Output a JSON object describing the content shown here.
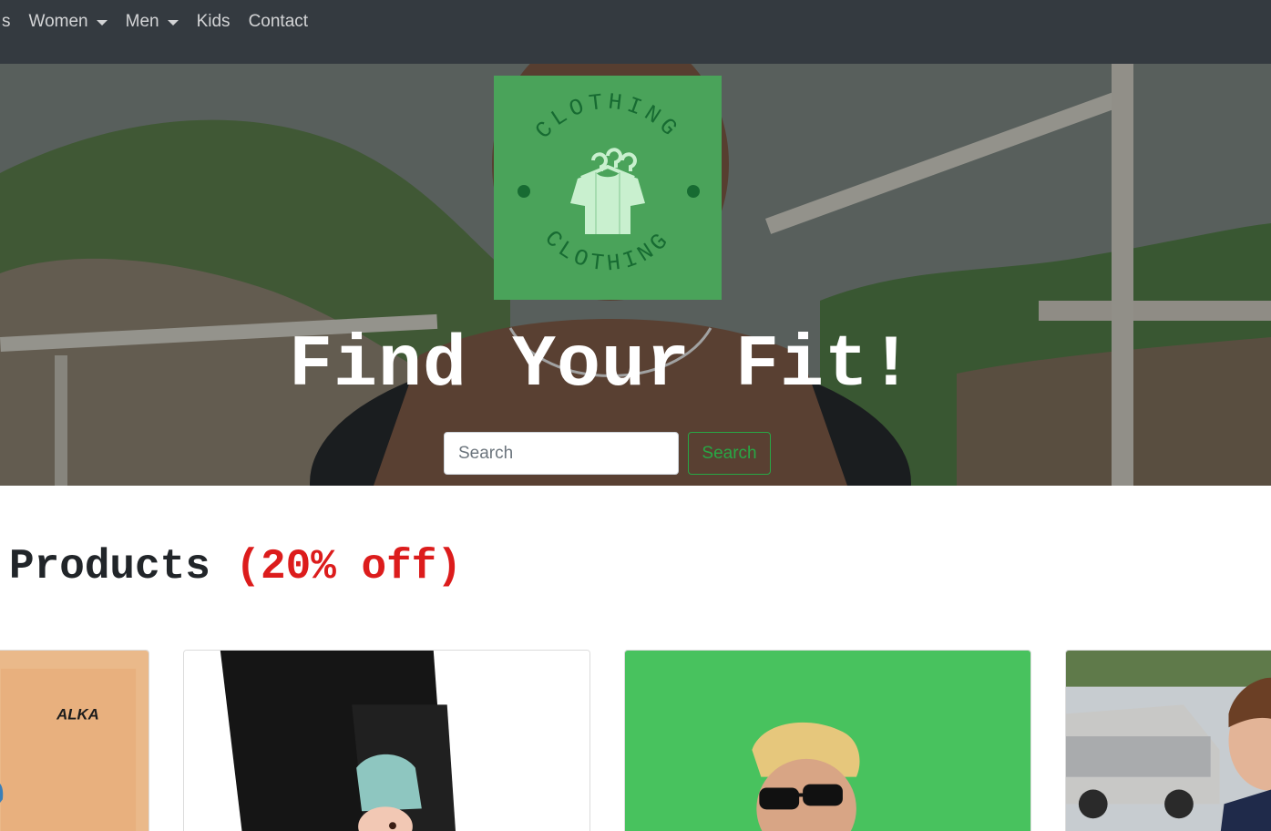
{
  "nav": {
    "items": [
      {
        "label": "s",
        "dropdown": false
      },
      {
        "label": "Women",
        "dropdown": true
      },
      {
        "label": "Men",
        "dropdown": true
      },
      {
        "label": "Kids",
        "dropdown": false
      },
      {
        "label": "Contact",
        "dropdown": false
      }
    ]
  },
  "hero": {
    "logo": {
      "brand_text_top": "CLOTHING",
      "brand_text_bottom": "CLOTHING",
      "icon": "hanger-shirt-icon"
    },
    "title": "Find Your Fit!",
    "search": {
      "placeholder": "Search",
      "value": "",
      "button_label": "Search"
    }
  },
  "products": {
    "heading": "Products",
    "discount_label": "(20% off)",
    "cards": [
      {
        "image": "orange-graphic-print-product",
        "print_text": "ALKA"
      },
      {
        "image": "black-cartoon-print-pants-product"
      },
      {
        "image": "blonde-man-sunglasses-green-backdrop-product"
      },
      {
        "image": "kid-street-cars-product"
      }
    ]
  },
  "colors": {
    "navbar_bg": "#343a40",
    "logo_bg": "#4aa35a",
    "logo_ink": "#176b32",
    "accent_green": "#28a745",
    "discount_red": "#dc1c1c"
  }
}
